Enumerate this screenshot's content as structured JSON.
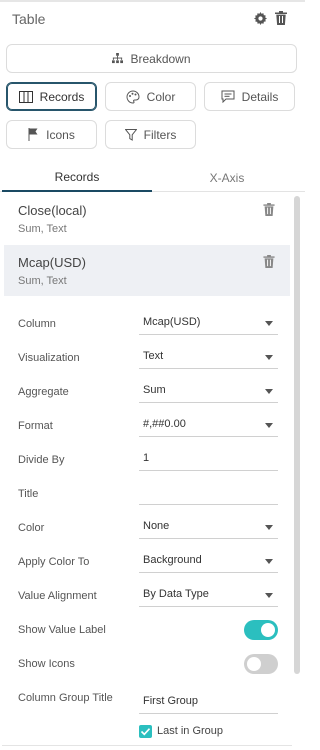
{
  "panel": {
    "title": "Table"
  },
  "buttons": {
    "breakdown": "Breakdown",
    "records": "Records",
    "color": "Color",
    "details": "Details",
    "icons": "Icons",
    "filters": "Filters"
  },
  "tabs": [
    {
      "label": "Records",
      "active": true
    },
    {
      "label": "X-Axis",
      "active": false
    }
  ],
  "records": [
    {
      "name": "Close(local)",
      "sub": "Sum, Text",
      "selected": false
    },
    {
      "name": "Mcap(USD)",
      "sub": "Sum, Text",
      "selected": true
    }
  ],
  "properties": {
    "column": {
      "label": "Column",
      "value": "Mcap(USD)"
    },
    "visualization": {
      "label": "Visualization",
      "value": "Text"
    },
    "aggregate": {
      "label": "Aggregate",
      "value": "Sum"
    },
    "format": {
      "label": "Format",
      "value": "#,##0.00"
    },
    "divide_by": {
      "label": "Divide By",
      "value": "1"
    },
    "title": {
      "label": "Title",
      "value": ""
    },
    "color": {
      "label": "Color",
      "value": "None"
    },
    "apply_color_to": {
      "label": "Apply Color To",
      "value": "Background"
    },
    "value_alignment": {
      "label": "Value Alignment",
      "value": "By Data Type"
    },
    "show_value_label": {
      "label": "Show Value Label",
      "on": true
    },
    "show_icons": {
      "label": "Show Icons",
      "on": false
    },
    "column_group_title": {
      "label": "Column Group Title",
      "value": "First Group"
    },
    "last_in_group": {
      "label": "Last in Group",
      "checked": true
    }
  },
  "colors": {
    "accent": "#2bbfbf",
    "selected_border": "#27556b",
    "tab_active": "#1a4a63"
  },
  "icons": [
    "gear-icon",
    "trash-icon",
    "hierarchy-icon",
    "columns-icon",
    "palette-icon",
    "comment-icon",
    "flag-icon",
    "filter-icon",
    "caret-down-icon",
    "check-icon"
  ]
}
